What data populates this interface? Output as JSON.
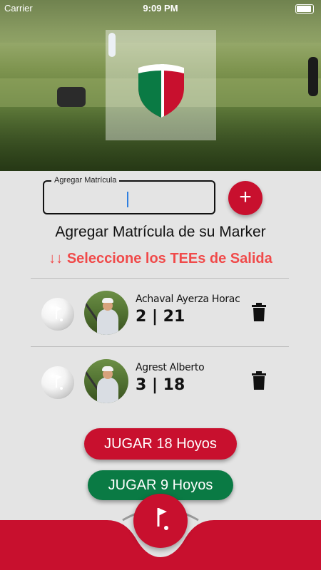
{
  "status_bar": {
    "carrier": "Carrier",
    "time": "9:09 PM"
  },
  "header": {
    "logo": "club-shield-logo",
    "colors": {
      "green": "#0a7a44",
      "red": "#c8102e"
    }
  },
  "marker_input": {
    "label": "Agregar Matrícula",
    "value": ""
  },
  "add_button": {
    "label": "+"
  },
  "title": "Agregar Matrícula de su Marker",
  "tees_prompt": "↓↓ Seleccione los TEEs de Salida",
  "players": [
    {
      "name": "Achaval Ayerza Horac",
      "score": "2 | 21"
    },
    {
      "name": "Agrest Alberto",
      "score": "3 | 18"
    }
  ],
  "buttons": {
    "play18": "JUGAR 18 Hoyos",
    "play9": "JUGAR 9 Hoyos"
  },
  "nav": {
    "center_icon": "golf-flag-icon"
  },
  "theme": {
    "accent_red": "#c8102e",
    "accent_green": "#0a7a44",
    "warning_text": "#f04a4a"
  }
}
